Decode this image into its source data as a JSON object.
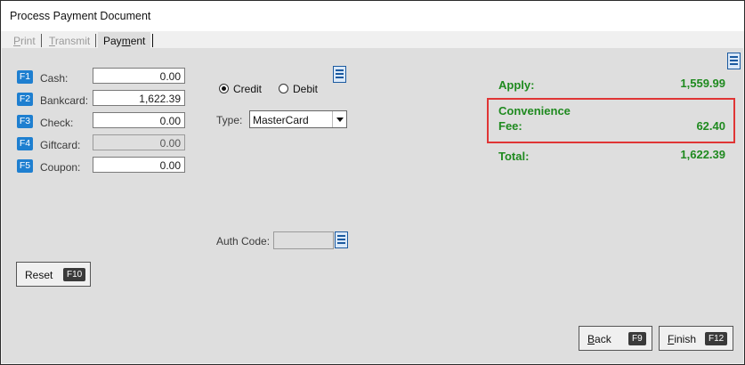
{
  "window": {
    "title": "Process Payment Document"
  },
  "tabs": [
    {
      "label": "Print",
      "state": "disabled"
    },
    {
      "label": "Transmit",
      "state": "disabled"
    },
    {
      "label": "Payment",
      "state": "active"
    }
  ],
  "payments": [
    {
      "key": "F1",
      "label": "Cash:",
      "value": "0.00",
      "editable": true
    },
    {
      "key": "F2",
      "label": "Bankcard:",
      "value": "1,622.39",
      "editable": true
    },
    {
      "key": "F3",
      "label": "Check:",
      "value": "0.00",
      "editable": true
    },
    {
      "key": "F4",
      "label": "Giftcard:",
      "value": "0.00",
      "editable": false
    },
    {
      "key": "F5",
      "label": "Coupon:",
      "value": "0.00",
      "editable": true
    }
  ],
  "card": {
    "credit_label": "Credit",
    "debit_label": "Debit",
    "selected": "Credit",
    "type_label": "Type:",
    "type_value": "MasterCard",
    "auth_label": "Auth Code:",
    "auth_value": ""
  },
  "summary": {
    "apply_label": "Apply:",
    "apply_value": "1,559.99",
    "fee_label_line1": "Convenience",
    "fee_label_line2": "Fee:",
    "fee_value": "62.40",
    "total_label": "Total:",
    "total_value": "1,622.39"
  },
  "buttons": {
    "reset": {
      "label": "Reset",
      "key": "F10"
    },
    "back": {
      "label": "Back",
      "key": "F9"
    },
    "finish": {
      "label": "Finish",
      "key": "F12"
    }
  },
  "colors": {
    "fkey_blue": "#1e7fd0",
    "summary_green": "#1f8a1f",
    "highlight_red": "#e03535"
  },
  "icons": {
    "menu": "menu-list-icon",
    "dropdown": "chevron-down-icon"
  }
}
